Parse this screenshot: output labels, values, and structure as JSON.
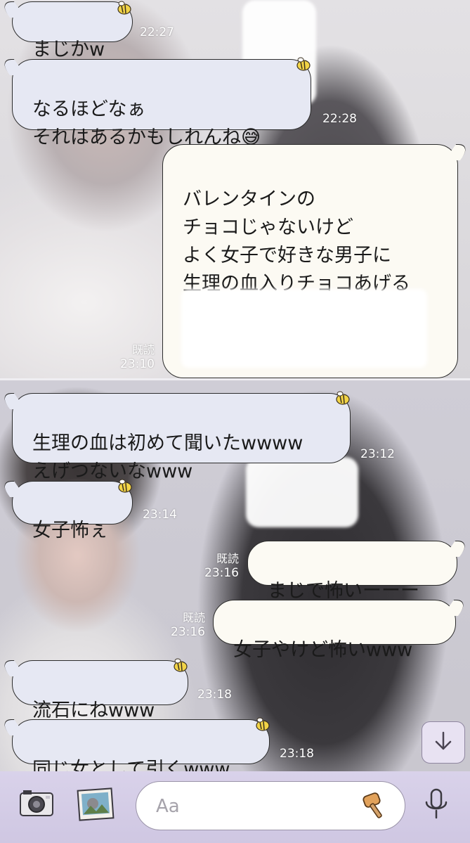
{
  "messages": [
    {
      "side": "in",
      "text": "まじかw",
      "time": "22:27",
      "read": ""
    },
    {
      "side": "in",
      "text": "なるほどなぁ\nそれはあるかもしれんね😅",
      "time": "22:28",
      "read": ""
    },
    {
      "side": "out",
      "text": "バレンタインの\nチョコじゃないけど\nよく女子で好きな男子に\n生理の血入りチョコあげる\nってよく聞かへん？",
      "time": "23:10",
      "read": "既読"
    },
    {
      "side": "in",
      "text": "生理の血は初めて聞いたwwww\nえげつないなwww",
      "time": "23:12",
      "read": ""
    },
    {
      "side": "in",
      "text": "女子怖ぇ",
      "time": "23:14",
      "read": ""
    },
    {
      "side": "out",
      "text": "まじで怖いーーー",
      "time": "23:16",
      "read": "既読"
    },
    {
      "side": "out",
      "text": "女子やけど怖いwww",
      "time": "23:16",
      "read": "既読"
    },
    {
      "side": "in",
      "text": "流石にねwww",
      "time": "23:18",
      "read": ""
    },
    {
      "side": "in",
      "text": "同じ女として引くwww",
      "time": "23:18",
      "read": ""
    }
  ],
  "input": {
    "placeholder": "Aa"
  },
  "icons": {
    "camera": "camera-icon",
    "gallery": "image-gallery-icon",
    "sticker": "hammer-sticker-icon",
    "mic": "microphone-icon",
    "scroll": "arrow-down-icon",
    "reaction": "bee-sticker-icon"
  },
  "colors": {
    "bubble_in": "#e6e8f3",
    "bubble_out": "#fcfaf3",
    "input_bar": "#d9d2ea",
    "timestamp": "#ffffff"
  }
}
